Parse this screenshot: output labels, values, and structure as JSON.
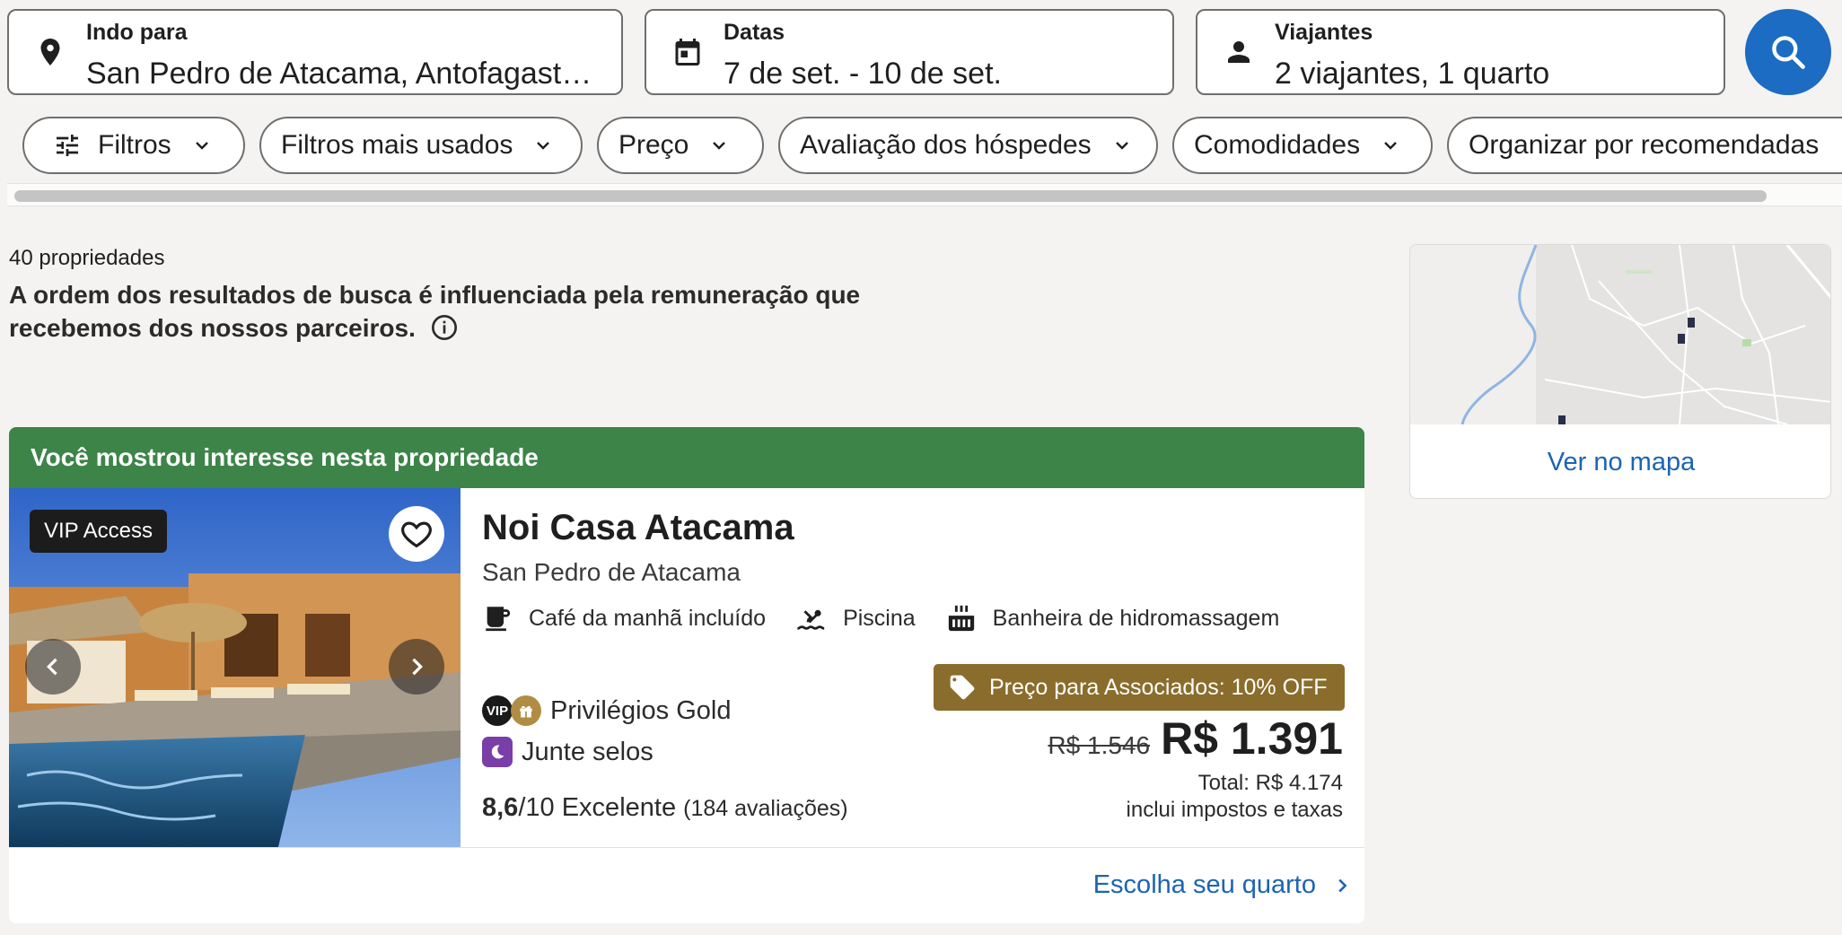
{
  "search": {
    "destination": {
      "label": "Indo para",
      "value": "San Pedro de Atacama, Antofagasta (..."
    },
    "dates": {
      "label": "Datas",
      "value": "7 de set. - 10 de set."
    },
    "travelers": {
      "label": "Viajantes",
      "value": "2 viajantes, 1 quarto"
    },
    "button_icon": "search-icon"
  },
  "filters": [
    {
      "label": "Filtros",
      "icon": "sliders-icon"
    },
    {
      "label": "Filtros mais usados"
    },
    {
      "label": "Preço"
    },
    {
      "label": "Avaliação dos hóspedes"
    },
    {
      "label": "Comodidades"
    },
    {
      "label": "Organizar por recomendadas"
    }
  ],
  "results": {
    "count": "40 propriedades",
    "disclaimer": "A ordem dos resultados de busca é influenciada pela remuneração que recebemos dos nossos parceiros."
  },
  "map": {
    "link": "Ver no mapa"
  },
  "property": {
    "banner": "Você mostrou interesse nesta propriedade",
    "badge": "VIP Access",
    "name": "Noi Casa Atacama",
    "location": "San Pedro de Atacama",
    "amenities": [
      {
        "icon": "coffee-cup-icon",
        "label": "Café da manhã incluído"
      },
      {
        "icon": "pool-icon",
        "label": "Piscina"
      },
      {
        "icon": "hot-tub-icon",
        "label": "Banheira de hidromassagem"
      }
    ],
    "loyalty": {
      "vip_mark": "VIP",
      "privileges": "Privilégios Gold",
      "stamps": "Junte selos"
    },
    "rating": {
      "score": "8,6",
      "scale": "/10",
      "label": "Excelente",
      "reviews": "(184 avaliações)"
    },
    "member_deal": "Preço para Associados: 10% OFF",
    "old_price": "R$ 1.546",
    "price": "R$ 1.391",
    "total": "Total: R$ 4.174",
    "taxes": "inclui impostos e taxas",
    "cta": "Escolha seu quarto"
  },
  "colors": {
    "accent": "#1b6cc2",
    "banner": "#3c8447",
    "member_badge": "#8a6d2c",
    "link": "#1b64b4"
  }
}
